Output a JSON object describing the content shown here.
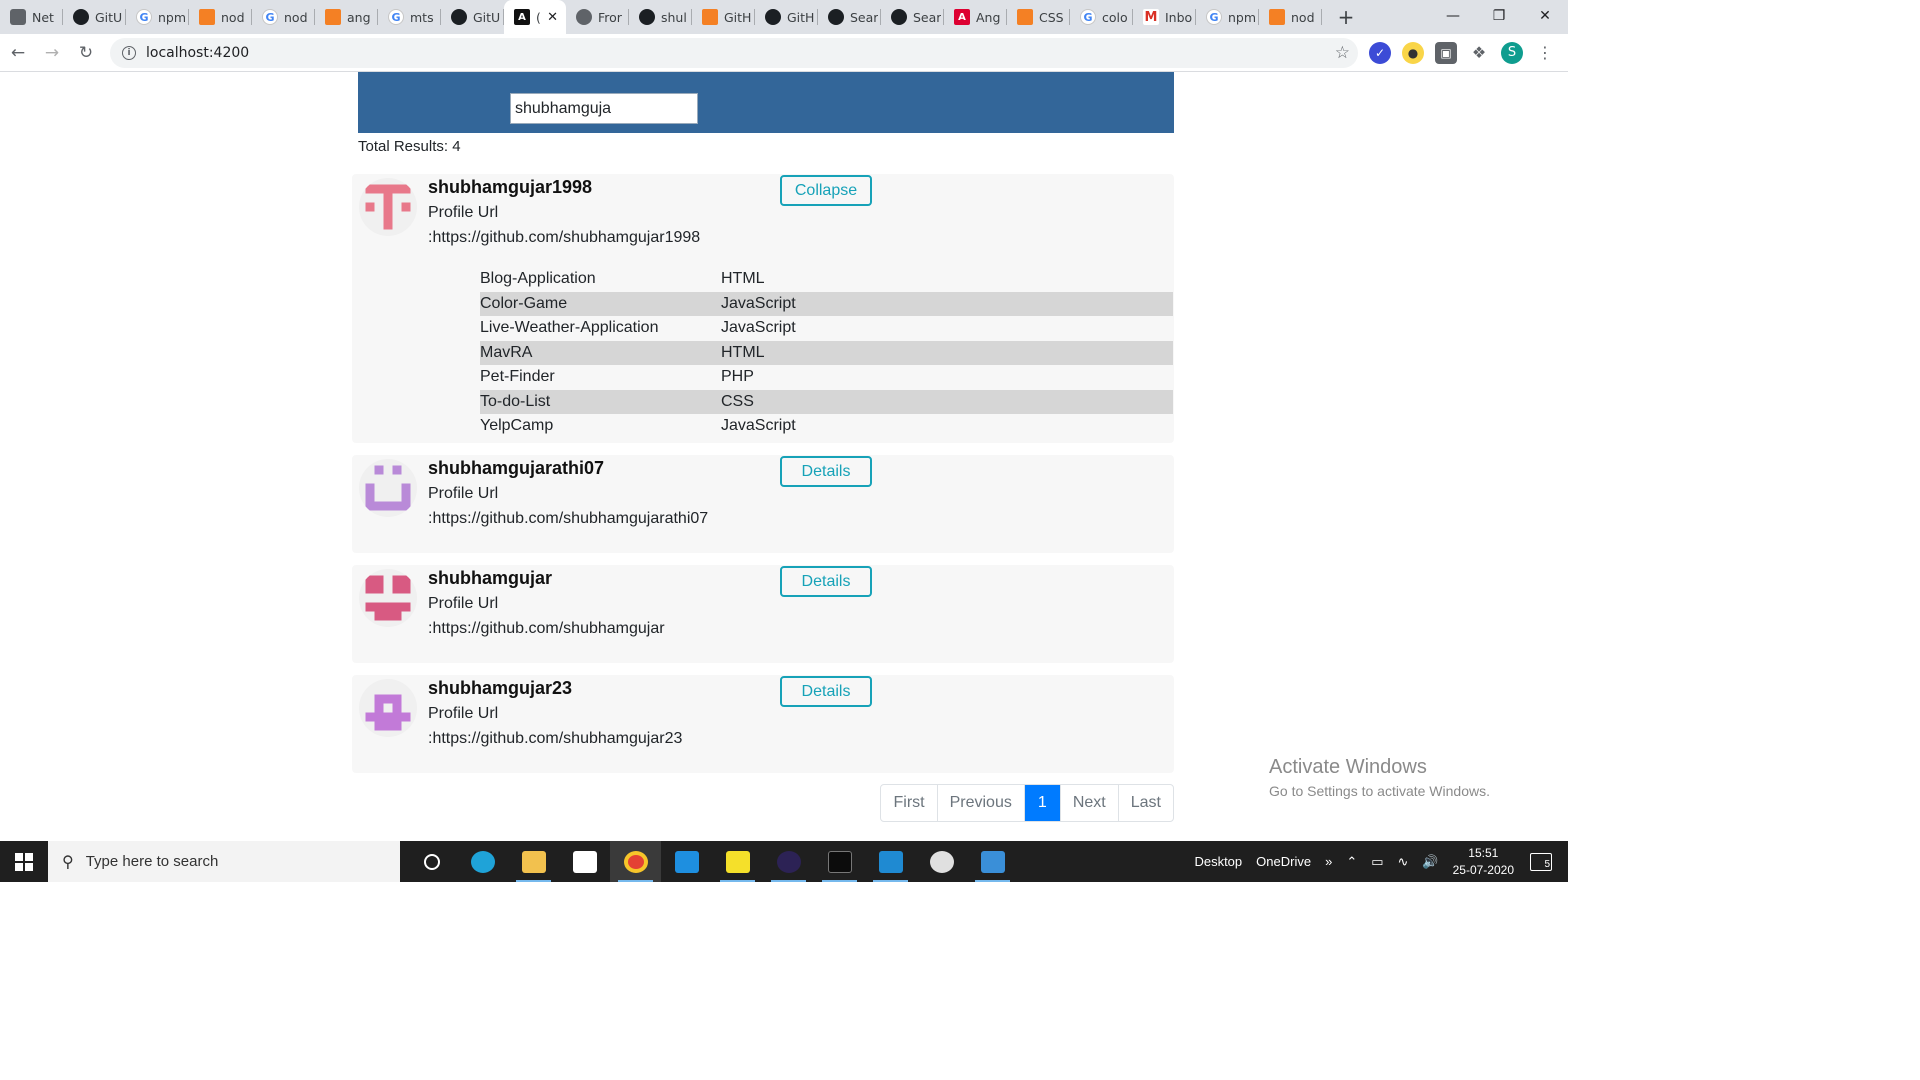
{
  "browser": {
    "tabs": [
      {
        "label": "Net",
        "icon": "lock-icon",
        "kind": "lock"
      },
      {
        "label": "GitU",
        "icon": "github-icon",
        "kind": "gh"
      },
      {
        "label": "npm",
        "icon": "google-icon",
        "kind": "g"
      },
      {
        "label": "nod",
        "icon": "stackoverflow-icon",
        "kind": "so"
      },
      {
        "label": "nod",
        "icon": "google-icon",
        "kind": "g"
      },
      {
        "label": "ang",
        "icon": "stackoverflow-icon",
        "kind": "so"
      },
      {
        "label": "mts",
        "icon": "google-icon",
        "kind": "g"
      },
      {
        "label": "GitU",
        "icon": "github-icon",
        "kind": "gh"
      },
      {
        "label": "(",
        "icon": "angular-icon",
        "kind": "ang",
        "active": true
      },
      {
        "label": "Fror",
        "icon": "globe-icon",
        "kind": "glb"
      },
      {
        "label": "shul",
        "icon": "github-icon",
        "kind": "gh"
      },
      {
        "label": "GitH",
        "icon": "stackoverflow-icon",
        "kind": "so"
      },
      {
        "label": "GitH",
        "icon": "github-icon",
        "kind": "gh"
      },
      {
        "label": "Sear",
        "icon": "github-icon",
        "kind": "gh"
      },
      {
        "label": "Sear",
        "icon": "github-icon",
        "kind": "gh"
      },
      {
        "label": "Ang",
        "icon": "angular-icon",
        "kind": "ng"
      },
      {
        "label": "CSS",
        "icon": "stackoverflow-icon",
        "kind": "so"
      },
      {
        "label": "colo",
        "icon": "google-icon",
        "kind": "g"
      },
      {
        "label": "Inbo",
        "icon": "gmail-icon",
        "kind": "gm"
      },
      {
        "label": "npm",
        "icon": "google-icon",
        "kind": "g"
      },
      {
        "label": "nod",
        "icon": "stackoverflow-icon",
        "kind": "so"
      }
    ],
    "url": "localhost:4200",
    "profile_initial": "S"
  },
  "search": {
    "value": "shubhamguja",
    "total_label": "Total Results: 4"
  },
  "users": [
    {
      "username": "shubhamgujar1998",
      "profile_label": "Profile Url",
      "profile_url": ":https://github.com/shubhamgujar1998",
      "button_label": "Collapse",
      "expanded": true,
      "avatar_color": "#e8788a",
      "repos": [
        {
          "name": "Blog-Application",
          "language": "HTML"
        },
        {
          "name": "Color-Game",
          "language": "JavaScript"
        },
        {
          "name": "Live-Weather-Application",
          "language": "JavaScript"
        },
        {
          "name": "MavRA",
          "language": "HTML"
        },
        {
          "name": "Pet-Finder",
          "language": "PHP"
        },
        {
          "name": "To-do-List",
          "language": "CSS"
        },
        {
          "name": "YelpCamp",
          "language": "JavaScript"
        }
      ]
    },
    {
      "username": "shubhamgujarathi07",
      "profile_label": "Profile Url",
      "profile_url": ":https://github.com/shubhamgujarathi07",
      "button_label": "Details",
      "expanded": false,
      "avatar_color": "#b98ad8"
    },
    {
      "username": "shubhamgujar",
      "profile_label": "Profile Url",
      "profile_url": ":https://github.com/shubhamgujar",
      "button_label": "Details",
      "expanded": false,
      "avatar_color": "#d85a82"
    },
    {
      "username": "shubhamgujar23",
      "profile_label": "Profile Url",
      "profile_url": ":https://github.com/shubhamgujar23",
      "button_label": "Details",
      "expanded": false,
      "avatar_color": "#c27ad8"
    }
  ],
  "pagination": {
    "first": "First",
    "previous": "Previous",
    "current": "1",
    "next": "Next",
    "last": "Last"
  },
  "watermark": {
    "title": "Activate Windows",
    "subtitle": "Go to Settings to activate Windows."
  },
  "taskbar": {
    "search_placeholder": "Type here to search",
    "desktop_label": "Desktop",
    "onedrive_label": "OneDrive",
    "time": "15:51",
    "date": "25-07-2020",
    "notification_count": "5"
  },
  "colors": {
    "header_blue": "#336699",
    "button_teal": "#17a2b8",
    "page_active": "#007bff",
    "stripe": "#d6d6d6"
  }
}
